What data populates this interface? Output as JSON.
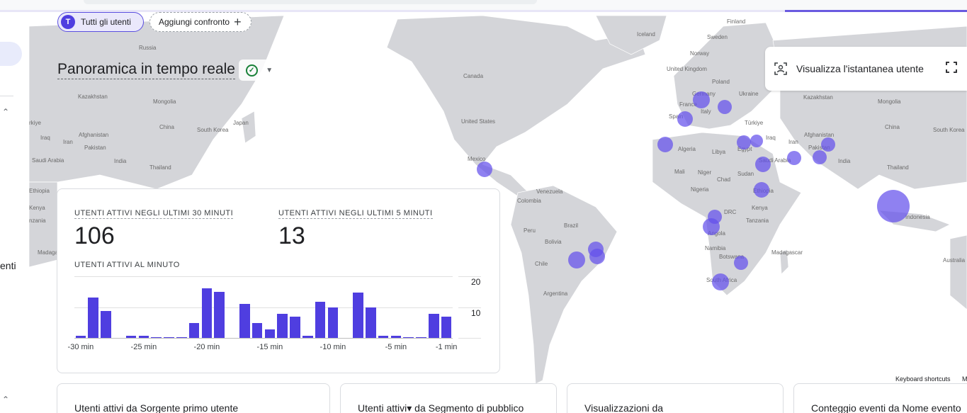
{
  "left_rail": {
    "partial_text": "enti"
  },
  "filters": {
    "all_users_avatar": "T",
    "all_users_label": "Tutti gli utenti",
    "add_comparison_label": "Aggiungi confronto"
  },
  "page": {
    "title": "Panoramica in tempo reale"
  },
  "snapshot": {
    "label": "Visualizza l'istantanea utente"
  },
  "card": {
    "metric_30_label": "UTENTI ATTIVI NEGLI ULTIMI 30 MINUTI",
    "metric_30_value": "106",
    "metric_5_label": "UTENTI ATTIVI NEGLI ULTIMI 5 MINUTI",
    "metric_5_value": "13",
    "per_minute_label": "UTENTI ATTIVI AL MINUTO"
  },
  "chart_data": {
    "type": "bar",
    "title": "UTENTI ATTIVI AL MINUTO",
    "x_tick_labels": [
      "-30 min",
      "-25 min",
      "-20 min",
      "-15 min",
      "-10 min",
      "-5 min",
      "-1 min"
    ],
    "y_tick_labels": [
      "20",
      "10"
    ],
    "ylim": [
      0,
      20
    ],
    "minutes": [
      -30,
      -29,
      -28,
      -27,
      -26,
      -25,
      -24,
      -23,
      -22,
      -21,
      -20,
      -19,
      -18,
      -17,
      -16,
      -15,
      -14,
      -13,
      -12,
      -11,
      -10,
      -9,
      -8,
      -7,
      -6,
      -5,
      -4,
      -3,
      -2,
      -1
    ],
    "values": [
      0.6,
      13,
      8.8,
      0,
      0.6,
      0.6,
      0.2,
      0.2,
      0.2,
      4.8,
      16,
      15,
      0,
      11,
      4.8,
      2.8,
      7.8,
      7,
      0.6,
      11.8,
      9.8,
      0,
      14.8,
      9.8,
      0.6,
      0.6,
      0.2,
      0.2,
      7.8,
      6.8
    ],
    "bar_color": "#4f3ee0",
    "grid": true
  },
  "map": {
    "labels": [
      {
        "text": "Finland",
        "key": "finland"
      },
      {
        "text": "Sweden",
        "key": "sweden"
      },
      {
        "text": "Iceland",
        "key": "iceland"
      },
      {
        "text": "Norway",
        "key": "norway"
      },
      {
        "text": "United Kingdom",
        "key": "uk"
      },
      {
        "text": "Poland",
        "key": "poland"
      },
      {
        "text": "Germany",
        "key": "germany"
      },
      {
        "text": "Ukraine",
        "key": "ukraine"
      },
      {
        "text": "France",
        "key": "france"
      },
      {
        "text": "Italy",
        "key": "italy"
      },
      {
        "text": "Spain",
        "key": "spain"
      },
      {
        "text": "Türkiye",
        "key": "turkiye"
      },
      {
        "text": "Kazakhstan",
        "key": "kazakhstan_e"
      },
      {
        "text": "Mongolia",
        "key": "mongolia_e"
      },
      {
        "text": "China",
        "key": "china_e"
      },
      {
        "text": "South Korea",
        "key": "skorea_e"
      },
      {
        "text": "Algeria",
        "key": "algeria"
      },
      {
        "text": "Libya",
        "key": "libya"
      },
      {
        "text": "Egypt",
        "key": "egypt"
      },
      {
        "text": "Iraq",
        "key": "iraq_e"
      },
      {
        "text": "Iran",
        "key": "iran_e"
      },
      {
        "text": "Afghanistan",
        "key": "afghanistan_e"
      },
      {
        "text": "Pakistan",
        "key": "pakistan_e"
      },
      {
        "text": "Saudi Arabia",
        "key": "saudi_e"
      },
      {
        "text": "India",
        "key": "india_e"
      },
      {
        "text": "Thailand",
        "key": "thailand_e"
      },
      {
        "text": "Mali",
        "key": "mali"
      },
      {
        "text": "Niger",
        "key": "niger"
      },
      {
        "text": "Chad",
        "key": "chad"
      },
      {
        "text": "Sudan",
        "key": "sudan"
      },
      {
        "text": "Nigeria",
        "key": "nigeria"
      },
      {
        "text": "Ethiopia",
        "key": "ethiopia_e"
      },
      {
        "text": "DRC",
        "key": "drc"
      },
      {
        "text": "Kenya",
        "key": "kenya_e"
      },
      {
        "text": "Tanzania",
        "key": "tanzania_e"
      },
      {
        "text": "Angola",
        "key": "angola"
      },
      {
        "text": "Namibia",
        "key": "namibia"
      },
      {
        "text": "Botswana",
        "key": "botswana"
      },
      {
        "text": "Madagascar",
        "key": "madagascar_e"
      },
      {
        "text": "South Africa",
        "key": "southafrica"
      },
      {
        "text": "Indonesia",
        "key": "indonesia"
      },
      {
        "text": "Australia",
        "key": "australia_e"
      },
      {
        "text": "Canada",
        "key": "canada"
      },
      {
        "text": "United States",
        "key": "usa"
      },
      {
        "text": "Mexico",
        "key": "mexico"
      },
      {
        "text": "Venezuela",
        "key": "venezuela"
      },
      {
        "text": "Colombia",
        "key": "colombia"
      },
      {
        "text": "Brazil",
        "key": "brazil"
      },
      {
        "text": "Peru",
        "key": "peru"
      },
      {
        "text": "Bolivia",
        "key": "bolivia"
      },
      {
        "text": "Chile",
        "key": "chile"
      },
      {
        "text": "Argentina",
        "key": "argentina"
      },
      {
        "text": "Russia",
        "key": "russia_w"
      },
      {
        "text": "Kazakhstan",
        "key": "kazakhstan_w"
      },
      {
        "text": "Mongolia",
        "key": "mongolia_w"
      },
      {
        "text": "China",
        "key": "china_w"
      },
      {
        "text": "South Korea",
        "key": "skorea_w"
      },
      {
        "text": "Japan",
        "key": "japan_w"
      },
      {
        "text": "rkiye",
        "key": "turkiye_w"
      },
      {
        "text": "Iraq",
        "key": "iraq_w"
      },
      {
        "text": "Iran",
        "key": "iran_w"
      },
      {
        "text": "Afghanistan",
        "key": "afghanistan_w"
      },
      {
        "text": "Pakistan",
        "key": "pakistan_w"
      },
      {
        "text": "Saudi Arabia",
        "key": "saudi_w"
      },
      {
        "text": "India",
        "key": "india_w"
      },
      {
        "text": "Thailand",
        "key": "thailand_w"
      },
      {
        "text": "Ethiopia",
        "key": "ethiopia_w"
      },
      {
        "text": "Kenya",
        "key": "kenya_w"
      },
      {
        "text": "nzania",
        "key": "tanzania_w"
      },
      {
        "text": "Madagascar",
        "key": "madagascar_w"
      },
      {
        "text": "China",
        "key": "china_far"
      },
      {
        "text": "South Korea",
        "key": "skorea_far"
      },
      {
        "text": "Australia",
        "key": "australia_far"
      }
    ],
    "bubble_color": "#6450eb"
  },
  "footer": {
    "keyboard_shortcuts": "Keyboard shortcuts",
    "truncated_right": "M"
  },
  "bottom_cards": [
    {
      "title": "Utenti attivi da Sorgente primo utente"
    },
    {
      "title": "Utenti attivi▾ da Segmento di pubblico"
    },
    {
      "title": "Visualizzazioni da"
    },
    {
      "title": "Conteggio eventi da Nome evento"
    }
  ]
}
